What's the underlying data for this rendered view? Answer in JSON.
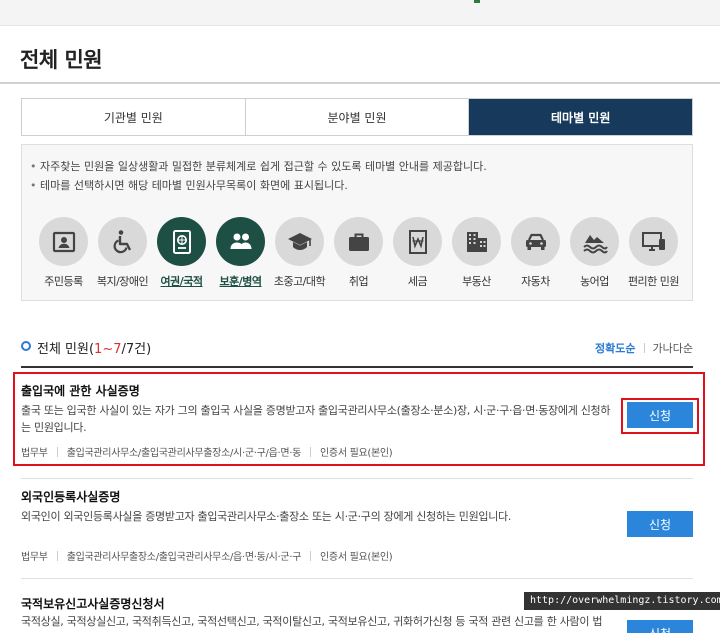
{
  "page_title": "전체 민원",
  "tabs": [
    {
      "label": "기관별 민원",
      "active": false
    },
    {
      "label": "분야별 민원",
      "active": false
    },
    {
      "label": "테마별 민원",
      "active": true
    }
  ],
  "notice": [
    "자주찾는 민원을 일상생활과 밀접한 분류체계로 쉽게 접근할 수 있도록 테마별 안내를 제공합니다.",
    "테마를 선택하시면 해당 테마별 민원사무목록이 화면에 표시됩니다."
  ],
  "themes": [
    {
      "label": "주민등록",
      "icon": "id-card-icon"
    },
    {
      "label": "복지/장애인",
      "icon": "wheelchair-icon"
    },
    {
      "label": "여권/국적",
      "icon": "passport-icon"
    },
    {
      "label": "보훈/병역",
      "icon": "people-icon"
    },
    {
      "label": "초중고/대학",
      "icon": "graduation-cap-icon"
    },
    {
      "label": "취업",
      "icon": "briefcase-icon"
    },
    {
      "label": "세금",
      "icon": "won-tax-icon"
    },
    {
      "label": "부동산",
      "icon": "building-icon"
    },
    {
      "label": "자동차",
      "icon": "car-icon"
    },
    {
      "label": "농어업",
      "icon": "wave-icon"
    },
    {
      "label": "편리한 민원",
      "icon": "monitor-icon"
    }
  ],
  "list": {
    "title_prefix": "전체 민원(",
    "range": "1~7",
    "total": "/7건)",
    "sort_accuracy": "정확도순",
    "sort_abc": "가나다순"
  },
  "items": [
    {
      "title": "출입국에 관한 사실증명",
      "desc": "출국 또는 입국한 사실이 있는 자가 그의 출입국 사실을 증명받고자 출입국관리사무소(출장소·분소)장, 시·군·구·읍·면·동장에게 신청하는 민원입니다.",
      "meta": [
        "법무부",
        "출입국관리사무소/출입국관리사무출장소/시·군·구/읍·면·동",
        "인증서 필요(본인)"
      ],
      "button": "신청"
    },
    {
      "title": "외국인등록사실증명",
      "desc": "외국인이 외국인등록사실을 증명받고자 출입국관리사무소·출장소 또는 시·군·구의 장에게 신청하는 민원입니다.",
      "meta": [
        "법무부",
        "출입국관리사무출장소/출입국관리사무소/읍·면·동/시·군·구",
        "인증서 필요(본인)"
      ],
      "button": "신청"
    },
    {
      "title": "국적보유신고사실증명신청서",
      "desc": "국적상실, 국적상실신고, 국적취득신고, 국적선택신고, 국적이탈신고, 국적보유신고, 귀화허가신청 등 국적 관련 신고를 한 사람이 법",
      "meta": [],
      "button": "신청"
    }
  ],
  "watermark": "http://overwhelmingz.tistory.com"
}
